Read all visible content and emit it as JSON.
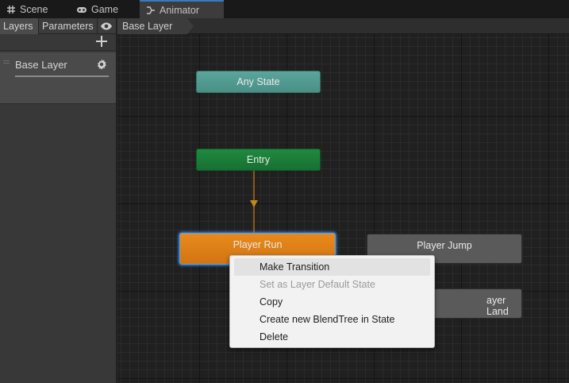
{
  "tabs": [
    {
      "label": "Scene",
      "icon": "grid-icon",
      "active": false
    },
    {
      "label": "Game",
      "icon": "gamepad-icon",
      "active": false
    },
    {
      "label": "Animator",
      "icon": "animator-icon",
      "active": true
    }
  ],
  "left_panel": {
    "tab_layers": "Layers",
    "tab_parameters": "Parameters",
    "layer_name": "Base Layer"
  },
  "breadcrumb": {
    "current": "Base Layer"
  },
  "states": {
    "any_state": "Any State",
    "entry": "Entry",
    "player_run": "Player Run",
    "player_jump": "Player Jump",
    "player_land": "Player Land",
    "player_land_visible": "ayer Land"
  },
  "context_menu": {
    "items": [
      {
        "label": "Make Transition",
        "enabled": true,
        "hover": true
      },
      {
        "label": "Set as Layer Default State",
        "enabled": false
      },
      {
        "label": "Copy",
        "enabled": true
      },
      {
        "label": "Create new BlendTree in State",
        "enabled": true
      },
      {
        "label": "Delete",
        "enabled": true
      }
    ]
  },
  "colors": {
    "any_state": "#5aa69c",
    "entry": "#1f8a3e",
    "default_state": "#e88a1c",
    "state": "#5a5a5a",
    "selection": "#4a9eff",
    "accent": "#3a79bb"
  }
}
